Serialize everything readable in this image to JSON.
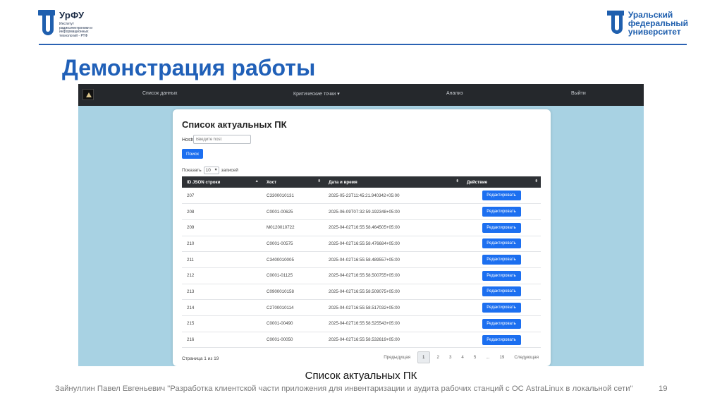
{
  "logo_left": {
    "abbr": "УрФУ",
    "institute": "Институт радиоэлектроники и информационных технологий - РТФ"
  },
  "logo_right": {
    "line1": "Уральский",
    "line2": "федеральный",
    "line3": "университет"
  },
  "slide_title": "Демонстрация работы",
  "navbar": {
    "items": [
      "Список данных",
      "Критические точки ▾",
      "Анализ",
      "Выйти"
    ]
  },
  "card": {
    "title": "Список актуальных ПК",
    "hosts_label": "Hosts",
    "hosts_placeholder": "Введите host",
    "search_button": "Поиск",
    "show_prefix": "Показать",
    "show_value": "10",
    "show_suffix": "записей",
    "columns": [
      "ID JSON строки",
      "Хост",
      "Дата и время",
      "Действие"
    ],
    "rows": [
      {
        "id": "207",
        "host": "C3300010131",
        "dt": "2025-05-23T11:45:21.940342+05:00",
        "action": "Редактировать"
      },
      {
        "id": "208",
        "host": "C0001-00625",
        "dt": "2025-06-09T07:32:59.192348+05:00",
        "action": "Редактировать"
      },
      {
        "id": "209",
        "host": "M0120010722",
        "dt": "2025-04-02T16:55:58.464505+05:00",
        "action": "Редактировать"
      },
      {
        "id": "210",
        "host": "C0001-00575",
        "dt": "2025-04-02T16:55:58.476684+05:00",
        "action": "Редактировать"
      },
      {
        "id": "211",
        "host": "C3400010005",
        "dt": "2025-04-02T16:55:58.489557+05:00",
        "action": "Редактировать"
      },
      {
        "id": "212",
        "host": "C0001-01125",
        "dt": "2025-04-02T16:55:58.500755+05:00",
        "action": "Редактировать"
      },
      {
        "id": "213",
        "host": "C0900010158",
        "dt": "2025-04-02T16:55:58.509075+05:00",
        "action": "Редактировать"
      },
      {
        "id": "214",
        "host": "C2700010114",
        "dt": "2025-04-02T16:55:58.517032+05:00",
        "action": "Редактировать"
      },
      {
        "id": "215",
        "host": "C0001-00490",
        "dt": "2025-04-02T16:55:58.525543+05:00",
        "action": "Редактировать"
      },
      {
        "id": "216",
        "host": "C0001-00050",
        "dt": "2025-04-02T16:55:58.532619+05:00",
        "action": "Редактировать"
      }
    ],
    "page_info": "Страница 1 из 19",
    "pager": {
      "prev": "Предыдущая",
      "pages": [
        "1",
        "2",
        "3",
        "4",
        "5",
        "...",
        "19"
      ],
      "next": "Следующая"
    }
  },
  "caption": "Список актуальных ПК",
  "credit": "Зайнуллин Павел Евгеньевич \"Разработка клиентской части приложения для инвентаризации и аудита рабочих станций с ОС AstraLinux в локальной сети\"",
  "page_number": "19",
  "colors": {
    "brand_blue": "#1f5fae",
    "title_blue": "#2060b8",
    "button_blue": "#1c6ff0",
    "navbar_dark": "#25282c",
    "background_light_blue": "#a8d2e3"
  }
}
